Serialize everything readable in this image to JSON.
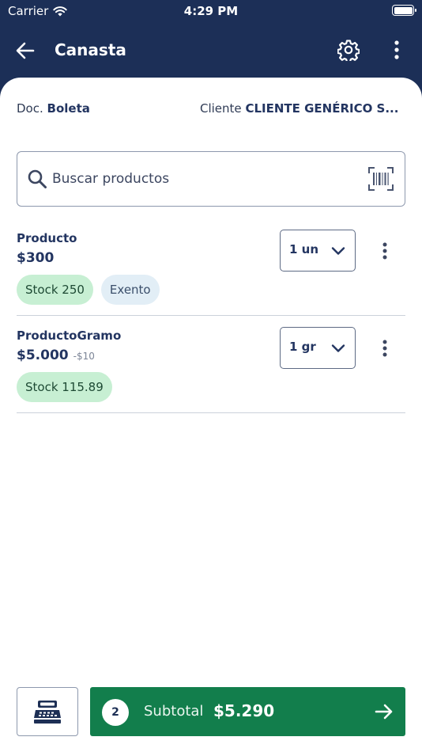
{
  "status_bar": {
    "carrier": "Carrier",
    "time": "4:29 PM"
  },
  "header": {
    "title": "Canasta"
  },
  "doc": {
    "doc_label": "Doc.",
    "doc_value": "Boleta",
    "client_label": "Cliente",
    "client_value": "CLIENTE GENÉRICO S..."
  },
  "search": {
    "placeholder": "Buscar productos"
  },
  "products": [
    {
      "name": "Producto",
      "price": "$300",
      "discount": "",
      "stock": "Stock 250",
      "exempt": "Exento",
      "qty": "1 un"
    },
    {
      "name": "ProductoGramo",
      "price": "$5.000",
      "discount": "-$10",
      "stock": "Stock 115.89",
      "qty": "1 gr"
    }
  ],
  "footer": {
    "count": "2",
    "subtotal_label": "Subtotal",
    "subtotal_value": "$5.290"
  },
  "colors": {
    "header_bg": "#1c2f57",
    "primary_text": "#233561",
    "subtotal_bg": "#127e4c",
    "stock_badge_bg": "#c7efd3",
    "exempt_badge_bg": "#e2eef6"
  },
  "icons": [
    "wifi-icon",
    "battery-icon",
    "back-arrow-icon",
    "gear-icon",
    "more-vertical-icon",
    "search-icon",
    "barcode-icon",
    "chevron-down-icon",
    "cash-register-icon",
    "arrow-right-icon"
  ]
}
